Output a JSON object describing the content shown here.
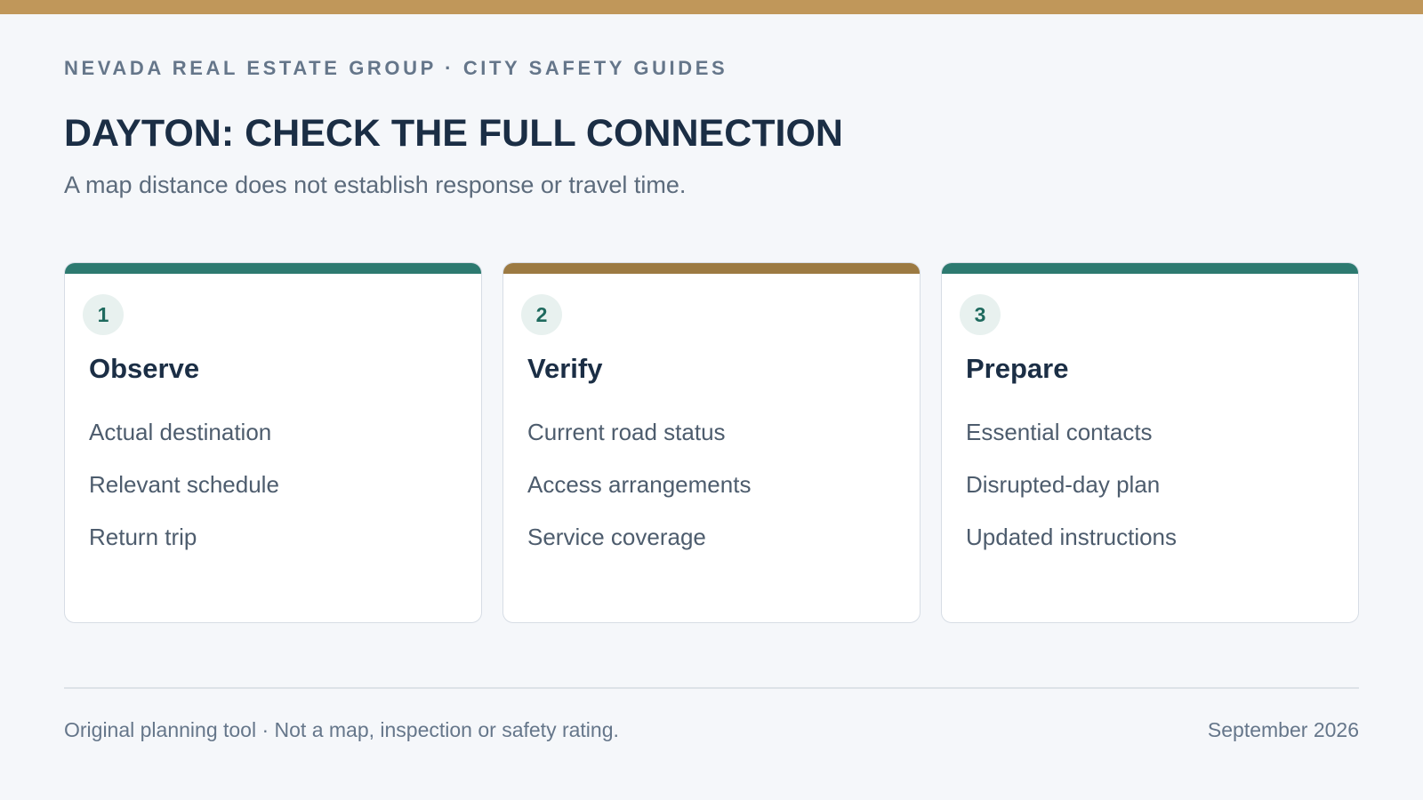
{
  "header": {
    "eyebrow": "NEVADA REAL ESTATE GROUP · CITY SAFETY GUIDES",
    "title": "DAYTON: CHECK THE FULL CONNECTION",
    "subtitle": "A map distance does not establish response or travel time."
  },
  "colors": {
    "top_bar": "#c0975a",
    "accent_teal": "#2d7a70",
    "accent_bronze": "#9c7a42"
  },
  "cards": [
    {
      "number": "1",
      "title": "Observe",
      "items": [
        "Actual destination",
        "Relevant schedule",
        "Return trip"
      ]
    },
    {
      "number": "2",
      "title": "Verify",
      "items": [
        "Current road status",
        "Access arrangements",
        "Service coverage"
      ]
    },
    {
      "number": "3",
      "title": "Prepare",
      "items": [
        "Essential contacts",
        "Disrupted-day plan",
        "Updated instructions"
      ]
    }
  ],
  "footer": {
    "note": "Original planning tool · Not a map, inspection or safety rating.",
    "date": "September 2026"
  }
}
